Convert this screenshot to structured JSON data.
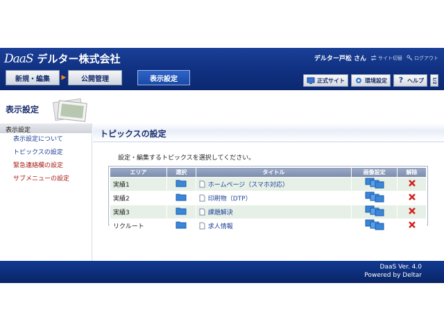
{
  "brand": {
    "logo": "DaaS",
    "company": "デルター株式会社"
  },
  "user": {
    "name": "デルター戸松 さん",
    "switch_site": "サイト切替",
    "logout": "ログアウト"
  },
  "tabs": [
    {
      "label": "新規・編集"
    },
    {
      "label": "公開管理"
    },
    {
      "label": "表示設定"
    }
  ],
  "tools": {
    "public_site": "正式サイト",
    "env_settings": "環境設定",
    "help": "ヘルプ",
    "extra": "1/2"
  },
  "page": {
    "title": "表示設定"
  },
  "sidebar": {
    "header": "表示設定",
    "items": [
      {
        "label": "表示設定について"
      },
      {
        "label": "トピックスの設定"
      },
      {
        "label": "緊急連絡欄の設定"
      },
      {
        "label": "サブメニューの設定"
      }
    ]
  },
  "main": {
    "section_title": "トピックスの設定",
    "description": "設定・編集するトピックスを選択してください。",
    "columns": [
      "エリア",
      "選択",
      "タイトル",
      "画像設定",
      "解除"
    ],
    "rows": [
      {
        "area": "実績1",
        "title": "ホームページ（スマホ対応）"
      },
      {
        "area": "実績2",
        "title": "印刷物（DTP）"
      },
      {
        "area": "実績3",
        "title": "課題解決"
      },
      {
        "area": "リクルート",
        "title": "求人情報"
      }
    ]
  },
  "footer": {
    "version": "DaaS Ver. 4.0",
    "powered": "Powered by Deltar"
  },
  "colors": {
    "header": "#0f2f7e",
    "link": "#1a3f97",
    "alert": "#a8201a",
    "delete": "#d42020"
  }
}
